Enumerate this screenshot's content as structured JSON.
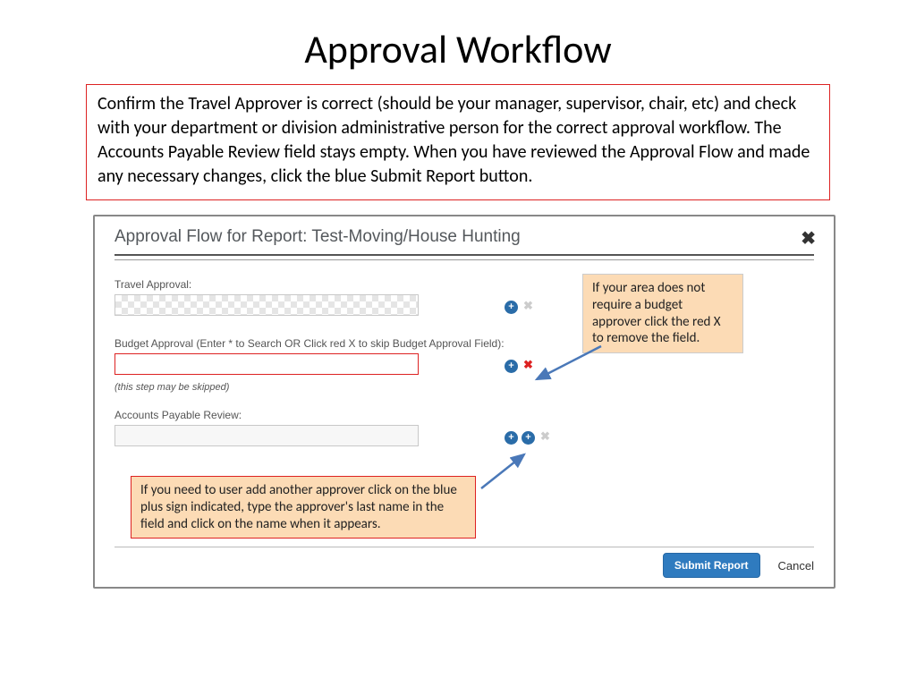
{
  "page_title": "Approval Workflow",
  "info_box": "Confirm the Travel Approver is correct (should be your manager, supervisor, chair, etc) and check with your department or division administrative person for the correct approval workflow.  The Accounts Payable Review field stays empty.  When you have reviewed the Approval Flow and made any necessary changes, click the blue Submit Report button.",
  "dialog": {
    "title": "Approval Flow for Report: Test-Moving/House Hunting",
    "fields": {
      "travel": {
        "label": "Travel Approval:",
        "value": ""
      },
      "budget": {
        "label": "Budget Approval (Enter * to Search OR Click red X to skip Budget Approval Field):",
        "value": "",
        "note": "(this step may be skipped)"
      },
      "ap": {
        "label": "Accounts Payable Review:",
        "value": ""
      }
    },
    "buttons": {
      "submit": "Submit Report",
      "cancel": "Cancel"
    }
  },
  "callouts": {
    "budget_x": "If your area does not require a budget approver click the red X to remove the field.",
    "add_approver": "If you need to user add another approver click on the blue plus sign indicated, type the approver's last name in the field and click on the name when it appears."
  }
}
